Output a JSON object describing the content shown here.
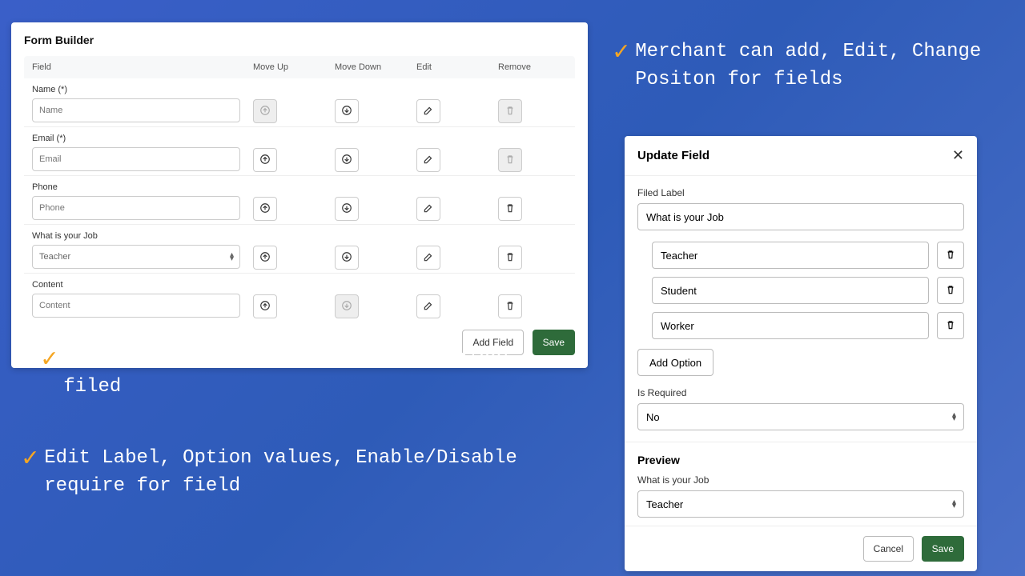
{
  "form_builder": {
    "title": "Form Builder",
    "columns": {
      "field": "Field",
      "up": "Move Up",
      "down": "Move Down",
      "edit": "Edit",
      "remove": "Remove"
    },
    "rows": [
      {
        "label": "Name (*)",
        "placeholder": "Name",
        "type": "text",
        "up_disabled": true,
        "remove_disabled": true
      },
      {
        "label": "Email (*)",
        "placeholder": "Email",
        "type": "text",
        "up_disabled": false,
        "remove_disabled": true
      },
      {
        "label": "Phone",
        "placeholder": "Phone",
        "type": "text",
        "up_disabled": false,
        "remove_disabled": false
      },
      {
        "label": "What is your Job",
        "value": "Teacher",
        "type": "select",
        "up_disabled": false,
        "remove_disabled": false
      },
      {
        "label": "Content",
        "placeholder": "Content",
        "type": "text",
        "up_disabled": false,
        "down_disabled": true,
        "remove_disabled": false
      }
    ],
    "add_field": "Add Field",
    "save": "Save"
  },
  "callouts": {
    "c1": "Merchant can add, Edit, Change Positon for fields",
    "c2": "Support Text, Dropdown, Multiple Select filed",
    "c3": "Edit Label, Option values, Enable/Disable require for field"
  },
  "update_field": {
    "title": "Update Field",
    "label_caption": "Filed Label",
    "label_value": "What is your Job",
    "options": [
      "Teacher",
      "Student",
      "Worker"
    ],
    "add_option": "Add Option",
    "required_caption": "Is Required",
    "required_value": "No",
    "preview_title": "Preview",
    "preview_label": "What is your Job",
    "preview_value": "Teacher",
    "cancel": "Cancel",
    "save": "Save"
  }
}
